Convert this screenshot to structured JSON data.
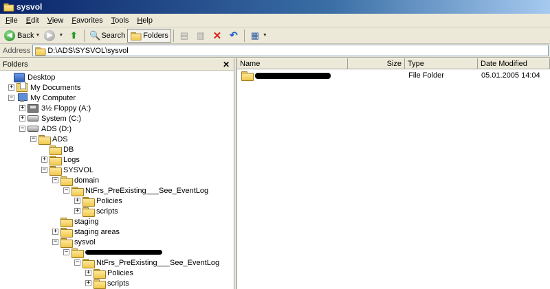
{
  "window": {
    "title": "sysvol"
  },
  "menu": [
    "File",
    "Edit",
    "View",
    "Favorites",
    "Tools",
    "Help"
  ],
  "toolbar": {
    "back_label": "Back",
    "search_label": "Search",
    "folders_label": "Folders"
  },
  "address": {
    "label": "Address",
    "path": "D:\\ADS\\SYSVOL\\sysvol"
  },
  "folders_pane": {
    "title": "Folders",
    "tree": [
      {
        "label": "Desktop",
        "icon": "desktop-icon",
        "expander": ""
      },
      {
        "label": "My Documents",
        "icon": "my-documents-icon",
        "expander": "+"
      },
      {
        "label": "My Computer",
        "icon": "my-computer-icon",
        "expander": "−"
      },
      {
        "label": "3½ Floppy (A:)",
        "icon": "floppy-drive-icon",
        "expander": "+"
      },
      {
        "label": "System (C:)",
        "icon": "hard-drive-icon",
        "expander": "+"
      },
      {
        "label": "ADS (D:)",
        "icon": "hard-drive-icon",
        "expander": "−"
      },
      {
        "label": "ADS",
        "icon": "folder-icon",
        "expander": "−"
      },
      {
        "label": "DB",
        "icon": "folder-icon",
        "expander": ""
      },
      {
        "label": "Logs",
        "icon": "folder-icon",
        "expander": "+"
      },
      {
        "label": "SYSVOL",
        "icon": "folder-icon",
        "expander": "−"
      },
      {
        "label": "domain",
        "icon": "folder-icon",
        "expander": "−"
      },
      {
        "label": "NtFrs_PreExisting___See_EventLog",
        "icon": "folder-icon",
        "expander": "−"
      },
      {
        "label": "Policies",
        "icon": "folder-icon",
        "expander": "+"
      },
      {
        "label": "scripts",
        "icon": "folder-icon",
        "expander": "+"
      },
      {
        "label": "staging",
        "icon": "folder-icon",
        "expander": ""
      },
      {
        "label": "staging areas",
        "icon": "folder-icon",
        "expander": "+"
      },
      {
        "label": "sysvol",
        "icon": "folder-icon",
        "expander": "−"
      },
      {
        "label": "",
        "icon": "folder-icon",
        "expander": "−"
      },
      {
        "label": "NtFrs_PreExisting___See_EventLog",
        "icon": "folder-icon",
        "expander": "−"
      },
      {
        "label": "Policies",
        "icon": "folder-icon",
        "expander": "+"
      },
      {
        "label": "scripts",
        "icon": "folder-icon",
        "expander": "+"
      }
    ]
  },
  "files_pane": {
    "columns": [
      "Name",
      "Size",
      "Type",
      "Date Modified"
    ],
    "rows": [
      {
        "name": "",
        "size": "",
        "type": "File Folder",
        "date_modified": "05.01.2005 14:04"
      }
    ]
  }
}
